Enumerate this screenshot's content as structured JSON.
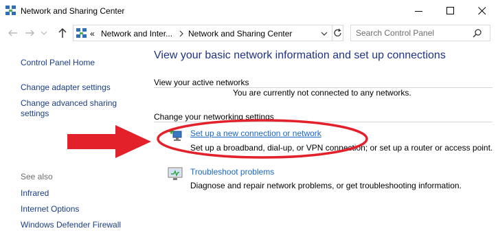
{
  "window": {
    "title": "Network and Sharing Center"
  },
  "address": {
    "overflow": "«",
    "crumbs": [
      "Network and Inter...",
      "Network and Sharing Center"
    ]
  },
  "search": {
    "placeholder": "Search Control Panel"
  },
  "sidebar": {
    "home": "Control Panel Home",
    "links": [
      "Change adapter settings",
      "Change advanced sharing",
      "settings"
    ],
    "see_also_heading": "See also",
    "see_also": [
      "Infrared",
      "Internet Options",
      "Windows Defender Firewall"
    ]
  },
  "main": {
    "title": "View your basic network information and set up connections",
    "active_networks_heading": "View your active networks",
    "active_networks_status": "You are currently not connected to any networks.",
    "change_settings_heading": "Change your networking settings",
    "tasks": [
      {
        "label": "Set up a new connection or network",
        "description": "Set up a broadband, dial-up, or VPN connection; or set up a router or access point.",
        "icon": "new-connection-icon"
      },
      {
        "label": "Troubleshoot problems",
        "description": "Diagnose and repair network problems, or get troubleshooting information.",
        "icon": "troubleshoot-icon"
      }
    ]
  },
  "annotation": {
    "color": "#e3212b"
  }
}
